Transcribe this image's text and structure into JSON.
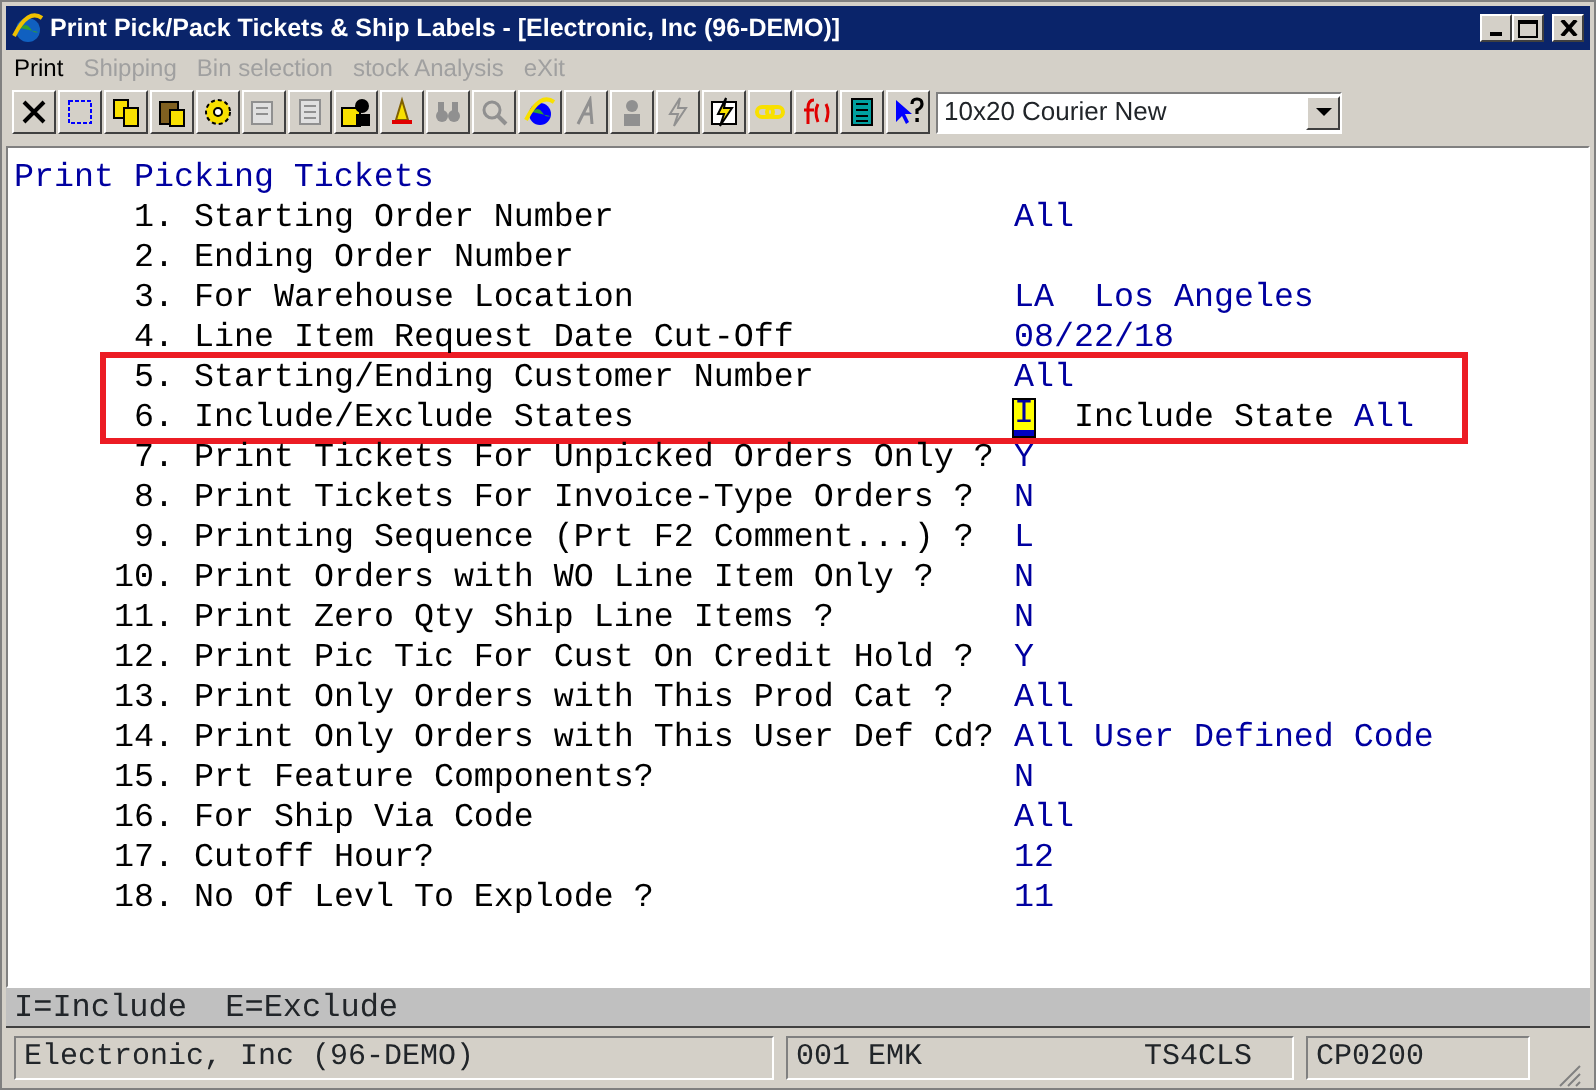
{
  "window": {
    "title": "Print Pick/Pack Tickets & Ship Labels - [Electronic, Inc (96-DEMO)]"
  },
  "menu": [
    {
      "label": "Print",
      "disabled": false
    },
    {
      "label": "Shipping",
      "disabled": true
    },
    {
      "label": "Bin selection",
      "disabled": true
    },
    {
      "label": "stock Analysis",
      "disabled": true
    },
    {
      "label": "eXit",
      "disabled": true
    }
  ],
  "toolbar": [
    {
      "disabled": false
    },
    {
      "disabled": false
    },
    {
      "disabled": false
    },
    {
      "disabled": false
    },
    {
      "disabled": false
    },
    {
      "disabled": true
    },
    {
      "disabled": true
    },
    {
      "disabled": false
    },
    {
      "disabled": false
    },
    {
      "disabled": true
    },
    {
      "disabled": true
    },
    {
      "disabled": false
    },
    {
      "disabled": true
    },
    {
      "disabled": true
    },
    {
      "disabled": true
    },
    {
      "disabled": false
    },
    {
      "disabled": false
    },
    {
      "disabled": false
    },
    {
      "disabled": false
    },
    {
      "disabled": false
    }
  ],
  "font_select": {
    "value": "10x20 Courier New"
  },
  "screen": {
    "heading": "Print Picking Tickets",
    "fields": [
      {
        "number": "1.",
        "label": "Starting Order Number",
        "value": "All",
        "highlighted": false
      },
      {
        "number": "2.",
        "label": "Ending Order Number",
        "highlighted": false
      },
      {
        "number": "3.",
        "label": "For Warehouse Location",
        "value": "LA  Los Angeles",
        "highlighted": false
      },
      {
        "number": "4.",
        "label": "Line Item Request Date Cut-Off",
        "value": "08/22/18",
        "highlighted": false
      },
      {
        "number": "5.",
        "label": "Starting/Ending Customer Number",
        "value": "All",
        "highlighted": true
      },
      {
        "number": "6.",
        "label": "Include/Exclude States",
        "value": "I",
        "focused": true,
        "extra_label": "Include State",
        "extra_value": "All",
        "highlighted": true
      },
      {
        "number": "7.",
        "label": "Print Tickets For Unpicked Orders Only ?",
        "value": "Y",
        "highlighted": false
      },
      {
        "number": "8.",
        "label": "Print Tickets For Invoice-Type Orders ?",
        "value": "N",
        "highlighted": false
      },
      {
        "number": "9.",
        "label": "Printing Sequence (Prt F2 Comment...) ?",
        "value": "L",
        "highlighted": false
      },
      {
        "number": "10.",
        "label": "Print Orders with WO Line Item Only ?",
        "value": "N",
        "highlighted": false
      },
      {
        "number": "11.",
        "label": "Print Zero Qty Ship Line Items ?",
        "value": "N",
        "highlighted": false
      },
      {
        "number": "12.",
        "label": "Print Pic Tic For Cust On Credit Hold ?",
        "value": "Y",
        "highlighted": false
      },
      {
        "number": "13.",
        "label": "Print Only Orders with This Prod Cat ?",
        "value": "All",
        "highlighted": false
      },
      {
        "number": "14.",
        "label": "Print Only Orders with This User Def Cd?",
        "value": "All User Defined Code",
        "highlighted": false
      },
      {
        "number": "15.",
        "label": "Prt Feature Components?",
        "value": "N",
        "highlighted": false
      },
      {
        "number": "16.",
        "label": "For Ship Via Code",
        "value": "All",
        "highlighted": false
      },
      {
        "number": "17.",
        "label": "Cutoff Hour?",
        "value": "12",
        "highlighted": false
      },
      {
        "number": "18.",
        "label": "No Of Levl To Explode ?",
        "value": "11",
        "highlighted": false
      }
    ],
    "hint": "I=Include  E=Exclude"
  },
  "status_bar": {
    "company": "Electronic, Inc (96-DEMO)",
    "user": "001 EMK",
    "station": "TS4CLS",
    "program": "CP0200"
  }
}
